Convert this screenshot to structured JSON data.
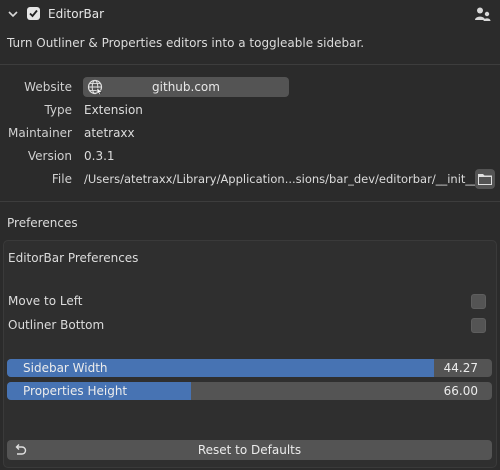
{
  "addon": {
    "name": "EditorBar",
    "description": "Turn Outliner & Properties editors into a toggleable sidebar.",
    "enabled": true
  },
  "info": {
    "website_label": "Website",
    "website_value": "github.com",
    "type_label": "Type",
    "type_value": "Extension",
    "maintainer_label": "Maintainer",
    "maintainer_value": "atetraxx",
    "version_label": "Version",
    "version_value": "0.3.1",
    "file_label": "File",
    "file_value": "/Users/atetraxx/Library/Application...sions/bar_dev/editorbar/__init__.py"
  },
  "preferences": {
    "section_label": "Preferences",
    "panel_title": "EditorBar Preferences",
    "move_to_left_label": "Move to Left",
    "move_to_left_checked": false,
    "outliner_bottom_label": "Outliner Bottom",
    "outliner_bottom_checked": false,
    "sidebar_width": {
      "label": "Sidebar Width",
      "value": "44.27",
      "fill_fraction": 0.88
    },
    "properties_height": {
      "label": "Properties Height",
      "value": "66.00",
      "fill_fraction": 0.38
    },
    "reset_label": "Reset to Defaults"
  },
  "colors": {
    "background": "#2b2b2b",
    "button": "#545454",
    "accent": "#4773b3"
  }
}
